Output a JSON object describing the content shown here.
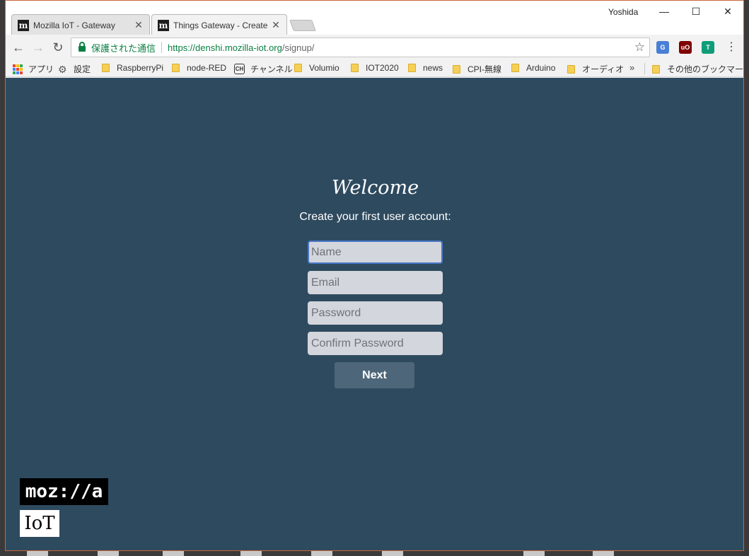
{
  "browser": {
    "user_name": "Yoshida",
    "window_controls": {
      "minimize": "—",
      "maximize": "☐",
      "close": "✕"
    },
    "tabs": [
      {
        "title": "Mozilla IoT - Gateway",
        "favicon": "m",
        "close": "✕"
      },
      {
        "title": "Things Gateway - Create",
        "favicon": "m",
        "close": "✕"
      }
    ],
    "nav": {
      "back": "←",
      "forward": "→",
      "reload": "↻"
    },
    "omnibox": {
      "secure_label": "保護された通信",
      "url_host": "https://denshi.mozilla-iot.org",
      "url_path": "/signup/",
      "star": "☆"
    },
    "extensions": [
      {
        "label": "G",
        "color": "#4a7fd6",
        "icon": "translate-extension-icon"
      },
      {
        "label": "uO",
        "color": "#800000",
        "icon": "ublock-extension-icon"
      },
      {
        "label": "T",
        "color": "#0f9d78",
        "icon": "tab-extension-icon"
      }
    ],
    "menu": "⋮",
    "bookmarks": [
      {
        "label": "アプリ",
        "icon": "apps-icon"
      },
      {
        "label": "設定",
        "icon": "gear-icon"
      },
      {
        "label": "RaspberryPi",
        "icon": "folder-icon"
      },
      {
        "label": "node-RED",
        "icon": "folder-icon"
      },
      {
        "label": "チャンネル",
        "icon": "ch-icon"
      },
      {
        "label": "Volumio",
        "icon": "folder-icon"
      },
      {
        "label": "IOT2020",
        "icon": "folder-icon"
      },
      {
        "label": "news",
        "icon": "folder-icon"
      },
      {
        "label": "CPI-無線",
        "icon": "folder-icon"
      },
      {
        "label": "Arduino",
        "icon": "folder-icon"
      },
      {
        "label": "オーディオ",
        "icon": "folder-icon"
      }
    ],
    "bookmarks_more": "»",
    "other_bookmarks": "その他のブックマーク",
    "ch_glyph": "CH",
    "gear_glyph": "⚙"
  },
  "page": {
    "background": "#2e4a5f",
    "title": "Welcome",
    "subtitle": "Create your first user account:",
    "fields": {
      "name_placeholder": "Name",
      "email_placeholder": "Email",
      "password_placeholder": "Password",
      "confirm_placeholder": "Confirm Password"
    },
    "next_label": "Next",
    "logo_mozilla": "moz://a",
    "logo_iot": "IoT"
  }
}
